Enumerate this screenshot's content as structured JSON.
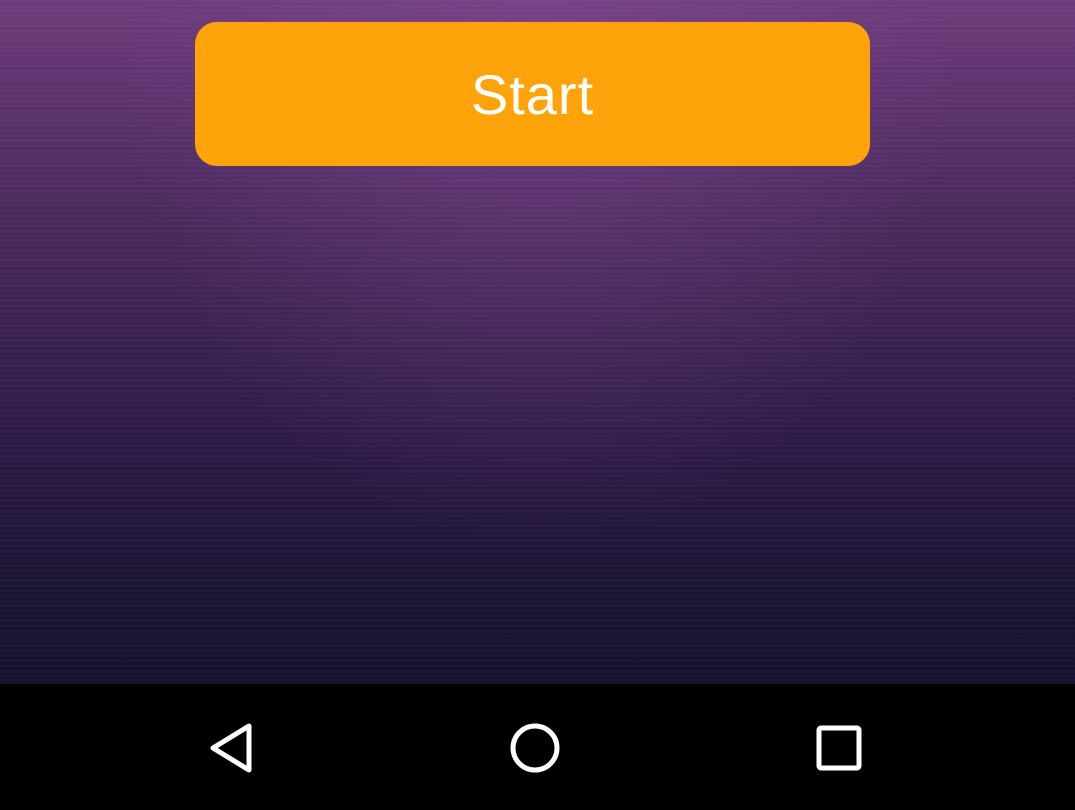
{
  "main": {
    "start_label": "Start"
  },
  "navigation_bar": {
    "back_icon": "back-triangle-icon",
    "home_icon": "home-circle-icon",
    "recents_icon": "recents-square-icon"
  },
  "colors": {
    "button": "#ffa30a",
    "nav_bar": "#000000",
    "nav_icon": "#ffffff"
  }
}
